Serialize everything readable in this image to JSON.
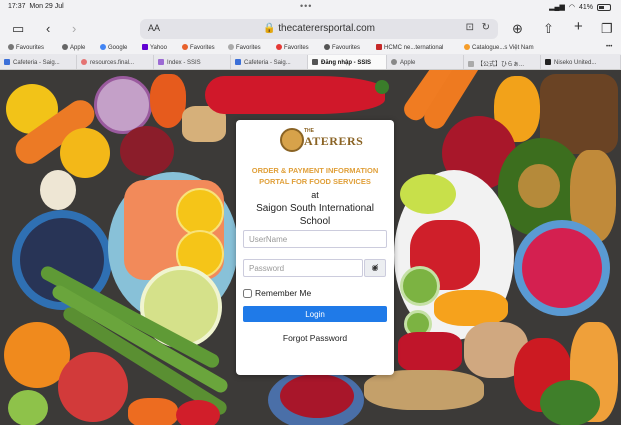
{
  "status": {
    "time": "17:37",
    "date": "Mon 29 Jul",
    "battery": "41%"
  },
  "browser": {
    "aa_label": "AA",
    "url": "thecaterersportal.com",
    "favorites": [
      {
        "label": "Favourites",
        "color": "#777"
      },
      {
        "label": "Apple",
        "color": "#666"
      },
      {
        "label": "Google",
        "color": "#4285f4"
      },
      {
        "label": "Yahoo",
        "color": "#6001d2"
      },
      {
        "label": "Favorites",
        "color": "#e8612c"
      },
      {
        "label": "Favorites",
        "color": "#aaa"
      },
      {
        "label": "Favorites",
        "color": "#e53935"
      },
      {
        "label": "Favourites",
        "color": "#555"
      },
      {
        "label": "HCMC ne...ternational",
        "color": "#c62828"
      },
      {
        "label": "Catalogue...s Việt Nam",
        "color": "#f59d2a"
      }
    ],
    "tabs": [
      {
        "label": "Cafeteria - Saig...",
        "color": "#3b6fd8",
        "active": false
      },
      {
        "label": "resources.final...",
        "color": "#e57373",
        "active": false
      },
      {
        "label": "Index - SSIS",
        "color": "#9c6ad4",
        "active": false
      },
      {
        "label": "Cafeteria - Saig...",
        "color": "#3b6fd8",
        "active": false
      },
      {
        "label": "Đăng nhập - SSIS",
        "color": "#555",
        "active": true
      },
      {
        "label": "Apple",
        "color": "#888",
        "active": false
      },
      {
        "label": "【公式】ひらぁ...",
        "color": "#aaa",
        "active": false
      },
      {
        "label": "Niseko United...",
        "color": "#222",
        "active": false
      }
    ]
  },
  "login": {
    "logo_the": "THE",
    "logo_name": "ATERERS",
    "title_line1": "ORDER & PAYMENT INFORMATION",
    "title_line2": "PORTAL FOR FOOD SERVICES",
    "at": "at",
    "school_line1": "Saigon South International",
    "school_line2": "School",
    "username_placeholder": "UserName",
    "password_placeholder": "Password",
    "remember_label": "Remember Me",
    "login_button": "Login",
    "forgot_link": "Forgot Password"
  }
}
